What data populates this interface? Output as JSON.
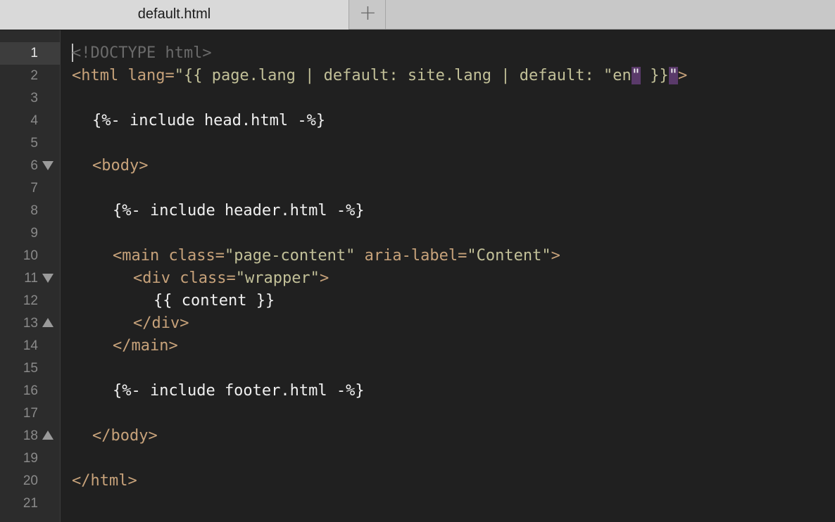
{
  "tab": {
    "title": "default.html",
    "new_tab_glyph": "+"
  },
  "gutter": {
    "line_numbers": [
      "1",
      "2",
      "3",
      "4",
      "5",
      "6",
      "7",
      "8",
      "9",
      "10",
      "11",
      "12",
      "13",
      "14",
      "15",
      "16",
      "17",
      "18",
      "19",
      "20",
      "21"
    ],
    "current_line": "1",
    "fold_markers": {
      "6": "collapse",
      "11": "collapse",
      "13": "expand",
      "18": "expand"
    }
  },
  "code": {
    "l1": "<!DOCTYPE html>",
    "l2_tag_open": "<html ",
    "l2_attr": "lang=",
    "l2_str_a": "\"{{ page.lang | default: site.lang | default: \"en",
    "l2_hl1": "\"",
    "l2_str_b": " }}",
    "l2_hl2": "\"",
    "l2_close": ">",
    "l4": "{%- include head.html -%}",
    "l6": "<body>",
    "l8": "{%- include header.html -%}",
    "l10_open": "<main ",
    "l10_attr1": "class=",
    "l10_val1": "\"page-content\"",
    "l10_attr2": " aria-label=",
    "l10_val2": "\"Content\"",
    "l10_close": ">",
    "l11_open": "<div ",
    "l11_attr": "class=",
    "l11_val": "\"wrapper\"",
    "l11_close": ">",
    "l12": "{{ content }}",
    "l13": "</div>",
    "l14": "</main>",
    "l16": "{%- include footer.html -%}",
    "l18": "</body>",
    "l20": "</html>"
  },
  "colors": {
    "background": "#202020",
    "gutter": "#2c2c2c",
    "tag": "#c7a27a",
    "string": "#c2c098",
    "doctype": "#6a6a6a",
    "text": "#f0f0f0",
    "bracket_highlight": "#5a3a6a"
  }
}
